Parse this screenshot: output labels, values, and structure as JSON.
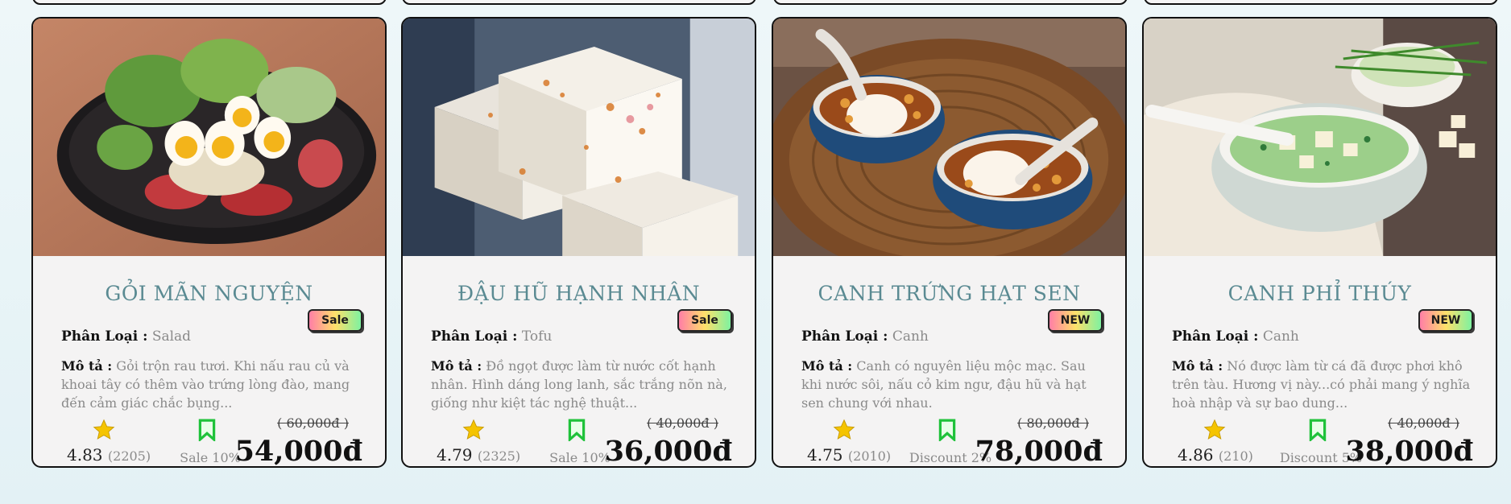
{
  "cards": [
    {
      "title": "GỎI MÃN NGUYỆN",
      "category_label": "Phân Loại :",
      "category": "Salad",
      "badge": "Sale",
      "desc_label": "Mô tả :",
      "description": "Gỏi trộn rau tươi. Khi nấu rau củ và khoai tây có thêm vào trứng lòng đào, mang đến cảm giác chắc bụng...",
      "rating": "4.83",
      "reviews": "(2205)",
      "discount": "Sale 10%",
      "old_price": "( 60,000đ )",
      "price": "54,000đ",
      "photo_icon": "salad-photo"
    },
    {
      "title": "ĐẬU HŨ HẠNH NHÂN",
      "category_label": "Phân Loại :",
      "category": "Tofu",
      "badge": "Sale",
      "desc_label": "Mô tả :",
      "description": "Đồ ngọt được làm từ nước cốt hạnh nhân. Hình dáng long lanh, sắc trắng nõn nà, giống như kiệt tác nghệ thuật...",
      "rating": "4.79",
      "reviews": "(2325)",
      "discount": "Sale 10%",
      "old_price": "( 40,000đ )",
      "price": "36,000đ",
      "photo_icon": "tofu-photo"
    },
    {
      "title": "CANH TRỨNG HẠT SEN",
      "category_label": "Phân Loại :",
      "category": "Canh",
      "badge": "NEW",
      "desc_label": "Mô tả :",
      "description": "Canh có nguyên liệu mộc mạc. Sau khi nước sôi, nấu cỏ kim ngư, đậu hũ và hạt sen chung với nhau.",
      "rating": "4.75",
      "reviews": "(2010)",
      "discount": "Discount 2%",
      "old_price": "( 80,000đ )",
      "price": "78,000đ",
      "photo_icon": "lotus-soup-photo"
    },
    {
      "title": "CANH PHỈ THÚY",
      "category_label": "Phân Loại :",
      "category": "Canh",
      "badge": "NEW",
      "desc_label": "Mô tả :",
      "description": "Nó được làm từ cá đã được phơi khô trên tàu. Hương vị này...có phải mang ý nghĩa hoà nhập và sự bao dung...",
      "rating": "4.86",
      "reviews": "(210)",
      "discount": "Discount 5%",
      "old_price": "( 40,000đ )",
      "price": "38,000đ",
      "photo_icon": "jade-soup-photo"
    }
  ],
  "colors": {
    "title": "#5a8a92",
    "star": "#f5c400",
    "bookmark": "#1fc23a"
  }
}
